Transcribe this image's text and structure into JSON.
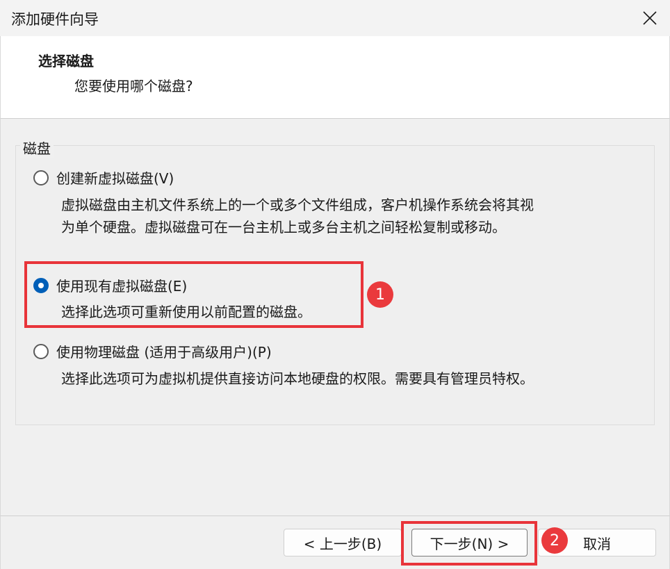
{
  "window": {
    "title": "添加硬件向导",
    "close_icon": "close-icon"
  },
  "header": {
    "title": "选择磁盘",
    "subtitle": "您要使用哪个磁盘?"
  },
  "group": {
    "legend": "磁盘",
    "options": [
      {
        "label": "创建新虚拟磁盘(V)",
        "checked": false,
        "desc_line1": "虚拟磁盘由主机文件系统上的一个或多个文件组成，客户机操作系统会将其视",
        "desc_line2": "为单个硬盘。虚拟磁盘可在一台主机上或多台主机之间轻松复制或移动。"
      },
      {
        "label": "使用现有虚拟磁盘(E)",
        "checked": true,
        "desc_line1": "选择此选项可重新使用以前配置的磁盘。"
      },
      {
        "label": "使用物理磁盘 (适用于高级用户)(P)",
        "checked": false,
        "desc_line1": "选择此选项可为虚拟机提供直接访问本地硬盘的权限。需要具有管理员特权。"
      }
    ]
  },
  "annotations": {
    "badge1": "1",
    "badge2": "2",
    "highlight_color": "#e8343a"
  },
  "footer": {
    "back_label": "< 上一步(B)",
    "next_label": "下一步(N) >",
    "cancel_label": "取消"
  },
  "colors": {
    "accent": "#005fb8",
    "annotation_red": "#ea3a3d"
  }
}
